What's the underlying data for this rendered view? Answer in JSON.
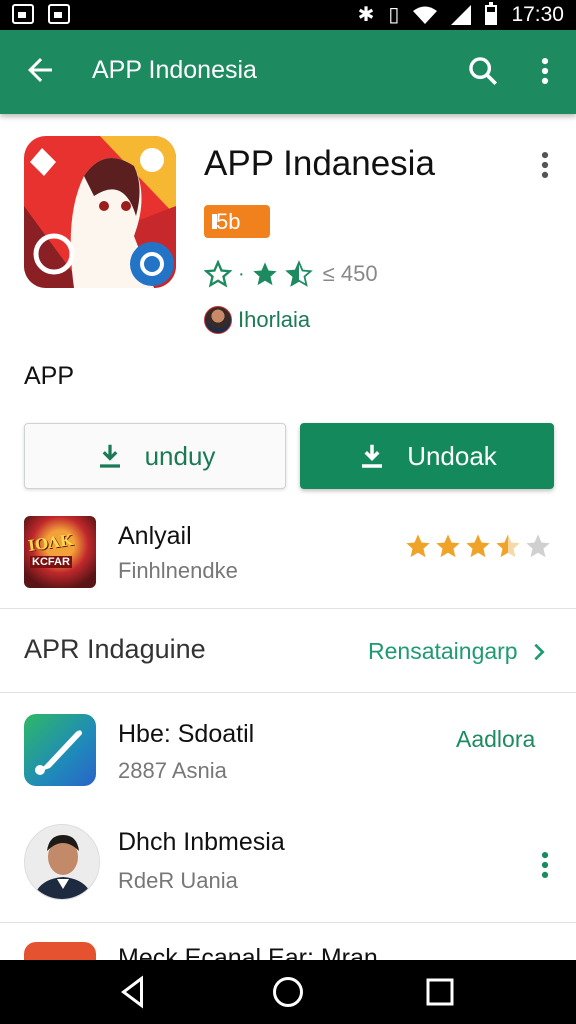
{
  "status_bar": {
    "time": "17:30"
  },
  "app_bar": {
    "title": "APP Indonesia"
  },
  "app": {
    "name": "APP Indanesia",
    "badge": "5b",
    "rating_count": "≤ 450",
    "developer": "Ihorlaia",
    "section_label": "APP"
  },
  "buttons": {
    "secondary_label": "unduy",
    "primary_label": "Undoak"
  },
  "featured": {
    "title": "Anlyail",
    "subtitle": "Finhlnendke",
    "icon_text_top": "ΙΟΛΚ",
    "icon_text_bottom": "KCFAR",
    "rating": 3.5
  },
  "section": {
    "title": "APR Indaguine",
    "link": "Rensataingarp"
  },
  "list": [
    {
      "title": "Hbe: Sdoatil",
      "subtitle": "2887 Asnia",
      "action": "Aadlora"
    },
    {
      "title": "Dhch Inbmesia",
      "subtitle": "RdeR Uania"
    },
    {
      "title": "Meck Ecanal Ear: Mran"
    }
  ],
  "colors": {
    "primary": "#1d8a60",
    "badge": "#f0811d",
    "star": "#f0a329",
    "link": "#1f9a73"
  }
}
